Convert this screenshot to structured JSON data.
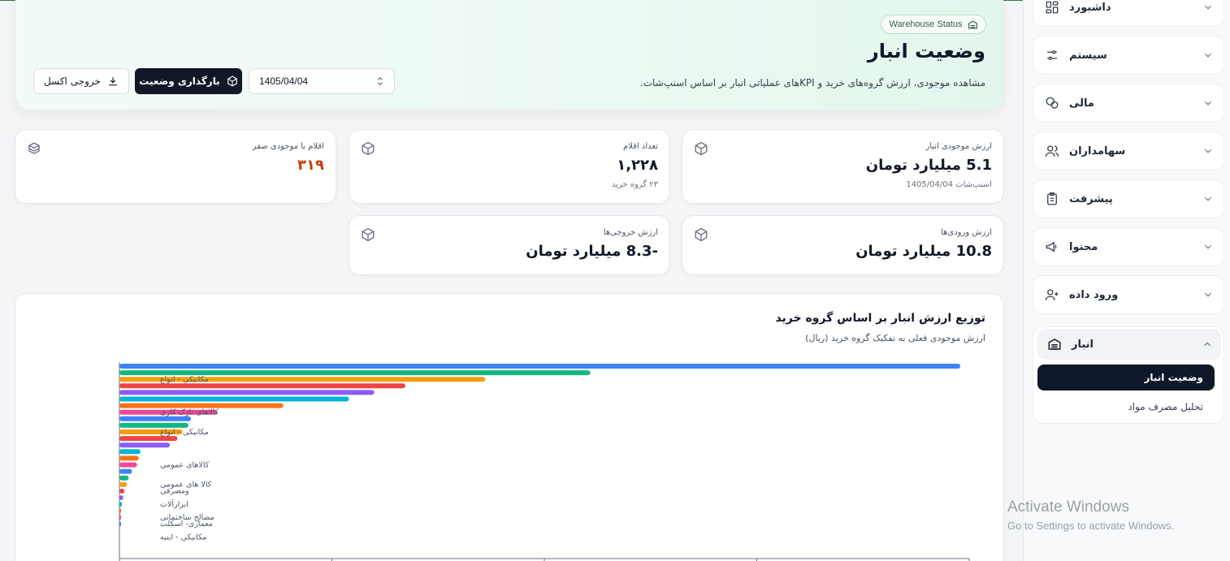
{
  "sidebar": {
    "items": [
      {
        "label": "داشبورد",
        "icon": "grid-icon"
      },
      {
        "label": "سیستم",
        "icon": "sliders-icon"
      },
      {
        "label": "مالی",
        "icon": "coins-icon"
      },
      {
        "label": "سهامداران",
        "icon": "users-icon"
      },
      {
        "label": "پیشرفت",
        "icon": "clipboard-icon"
      },
      {
        "label": "محتوا",
        "icon": "megaphone-icon"
      },
      {
        "label": "ورود داده",
        "icon": "user-plus-icon"
      }
    ],
    "group": {
      "label": "انبار",
      "icon": "warehouse-icon",
      "subitems": [
        "وضعیت انبار",
        "تحلیل مصرف مواد"
      ]
    }
  },
  "header": {
    "badge": "Warehouse Status",
    "title": "وضعیت انبار",
    "subtitle": "مشاهده موجودی، ارزش گروه‌های خرید و KPIهای عملیاتی انبار بر اساس اسنپ‌شات.",
    "date_value": "1405/04/04",
    "load_button": "بارگذاری وضعیت",
    "export_button": "خروجی اکسل"
  },
  "kpis": {
    "stock_value": {
      "label": "ارزش موجودی انبار",
      "value": "5.1 میلیارد تومان",
      "hint": "اسنپ‌شات 1405/04/04"
    },
    "item_count": {
      "label": "تعداد اقلام",
      "value": "۱,۲۲۸",
      "hint": "۲۳ گروه خرید"
    },
    "zero_stock": {
      "label": "اقلام با موجودی صفر",
      "value": "۳۱۹"
    },
    "inbound_value": {
      "label": "ارزش ورودی‌ها",
      "value": "10.8 میلیارد تومان"
    },
    "outbound_value": {
      "label": "ارزش خروجی‌ها",
      "value": "-8.3 میلیارد تومان"
    }
  },
  "chart": {
    "title": "توزیع ارزش انبار بر اساس گروه خرید",
    "subtitle": "ارزش موجودی فعلی به تفکیک گروه خرید (ریال)"
  },
  "chart_data": {
    "type": "bar",
    "orientation": "horizontal",
    "categories": [
      "مکانیکی - انواع",
      "",
      "",
      "",
      "",
      "کالاهای نازک کاری",
      "",
      "",
      "مکانیکی - انواع",
      "",
      "",
      "",
      "",
      "کالاهای عمومی",
      "",
      "",
      "کالا های عمومی",
      "ومصرفی",
      "",
      "ابزارآلات",
      "",
      "مصالح ساختمانی",
      "معماری- اسکلت",
      "",
      "مکانیکی - ابنیه"
    ],
    "values": [
      100,
      56,
      43.5,
      34,
      30.3,
      27.3,
      19.5,
      11.6,
      8.5,
      8.2,
      7.5,
      6.9,
      6,
      2.5,
      2.3,
      2.1,
      1.5,
      1.1,
      0.9,
      0.6,
      0.45,
      0.3,
      0.2,
      0.1,
      0.05
    ],
    "colors": [
      "#3b82f6",
      "#10b981",
      "#f59e0b",
      "#ef4444",
      "#8b5cf6",
      "#06b6d4",
      "#f97316",
      "#ec4899",
      "#3b82f6",
      "#10b981",
      "#f59e0b",
      "#ef4444",
      "#8b5cf6",
      "#06b6d4",
      "#f97316",
      "#ec4899",
      "#3b82f6",
      "#10b981",
      "#f59e0b",
      "#ef4444",
      "#8b5cf6",
      "#06b6d4",
      "#f97316",
      "#ec4899",
      "#3b82f6"
    ],
    "xlim": [
      0,
      100
    ],
    "grid": true
  },
  "watermark": {
    "line1": "Activate Windows",
    "line2": "Go to Settings to activate Windows."
  }
}
